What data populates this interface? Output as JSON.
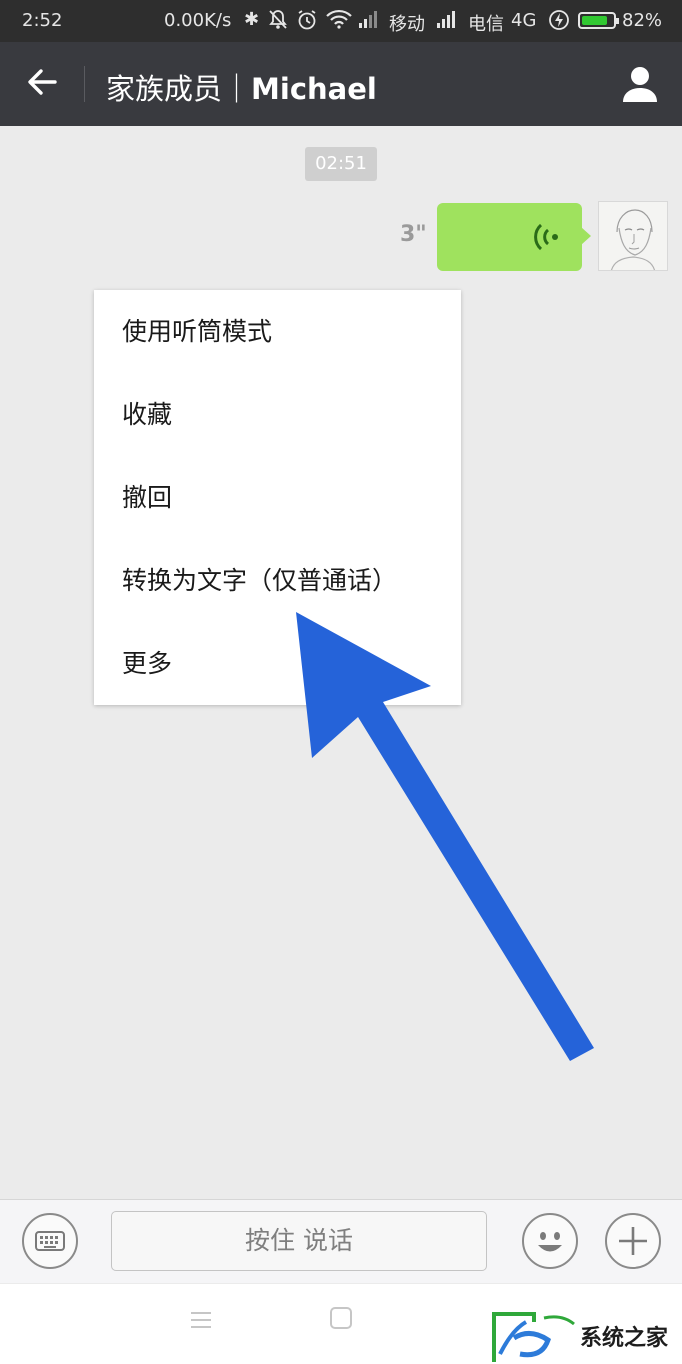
{
  "status_bar": {
    "time": "2:52",
    "net_speed": "0.00K/s",
    "carrier1": "移动",
    "carrier2": "电信",
    "network_type": "4G",
    "battery_level": 0.82,
    "battery_text": "82%",
    "battery_color": "#32c832"
  },
  "header": {
    "group_name": "家族成员",
    "separator": "｜",
    "contact_name": "Michael",
    "background": "#393a3f"
  },
  "chat": {
    "timestamp": "02:51",
    "voice_duration": "3\"",
    "bubble_color": "#9fe25e"
  },
  "context_menu": {
    "items": [
      "使用听筒模式",
      "收藏",
      "撤回",
      "转换为文字（仅普通话）",
      "更多"
    ]
  },
  "input_bar": {
    "hold_to_talk": "按住 说话"
  },
  "annotation": {
    "arrow_color": "#2563d9"
  },
  "watermark": {
    "text": "系统之家"
  }
}
